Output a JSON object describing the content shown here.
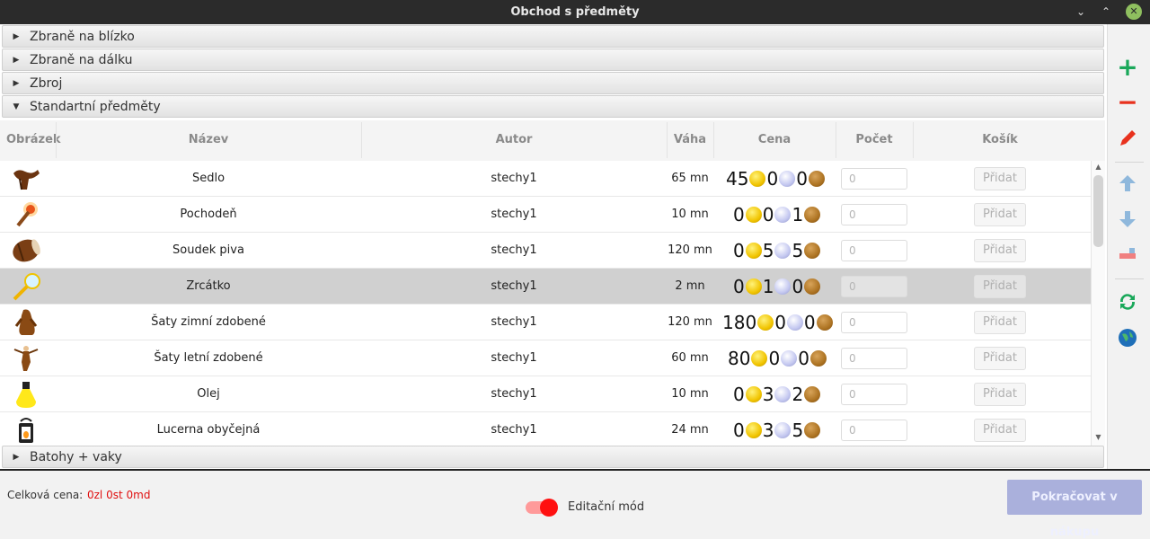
{
  "window": {
    "title": "Obchod s předměty"
  },
  "accordion": {
    "sections": [
      "Zbraně na blízko",
      "Zbraně na dálku",
      "Zbroj",
      "Standartní předměty"
    ],
    "after": "Batohy + vaky"
  },
  "table": {
    "headers": {
      "image": "Obrázek",
      "name": "Název",
      "author": "Autor",
      "weight": "Váha",
      "price": "Cena",
      "count": "Počet",
      "cart": "Košík"
    },
    "rows": [
      {
        "name": "Sedlo",
        "author": "stechy1",
        "weight": "65 mn",
        "gold": "45",
        "silver": "0",
        "copper": "0",
        "qty_placeholder": "0",
        "add": "Přidat",
        "icon": "saddle-icon"
      },
      {
        "name": "Pochodeň",
        "author": "stechy1",
        "weight": "10 mn",
        "gold": "0",
        "silver": "0",
        "copper": "1",
        "qty_placeholder": "0",
        "add": "Přidat",
        "icon": "torch-icon"
      },
      {
        "name": "Soudek piva",
        "author": "stechy1",
        "weight": "120 mn",
        "gold": "0",
        "silver": "5",
        "copper": "5",
        "qty_placeholder": "0",
        "add": "Přidat",
        "icon": "barrel-icon"
      },
      {
        "name": "Zrcátko",
        "author": "stechy1",
        "weight": "2 mn",
        "gold": "0",
        "silver": "1",
        "copper": "0",
        "qty_placeholder": "0",
        "add": "Přidat",
        "icon": "mirror-icon"
      },
      {
        "name": "Šaty zimní zdobené",
        "author": "stechy1",
        "weight": "120 mn",
        "gold": "180",
        "silver": "0",
        "copper": "0",
        "qty_placeholder": "0",
        "add": "Přidat",
        "icon": "winter-clothes-icon"
      },
      {
        "name": "Šaty letní zdobené",
        "author": "stechy1",
        "weight": "60 mn",
        "gold": "80",
        "silver": "0",
        "copper": "0",
        "qty_placeholder": "0",
        "add": "Přidat",
        "icon": "summer-clothes-icon"
      },
      {
        "name": "Olej",
        "author": "stechy1",
        "weight": "10 mn",
        "gold": "0",
        "silver": "3",
        "copper": "2",
        "qty_placeholder": "0",
        "add": "Přidat",
        "icon": "oil-flask-icon"
      },
      {
        "name": "Lucerna obyčejná",
        "author": "stechy1",
        "weight": "24 mn",
        "gold": "0",
        "silver": "3",
        "copper": "5",
        "qty_placeholder": "0",
        "add": "Přidat",
        "icon": "lantern-icon"
      }
    ],
    "selected_row_index": 3
  },
  "toolbar": {
    "icons": [
      "add-icon",
      "remove-icon",
      "edit-icon",
      "move-up-icon",
      "move-down-icon",
      "eraser-icon",
      "sync-icon",
      "globe-icon"
    ],
    "colors": {
      "add": "#1aa85a",
      "remove": "#e8321e",
      "edit": "#e8321e",
      "arrows": "#8fb8dc",
      "sync": "#1aa85a",
      "globe": "#1f6fb8"
    }
  },
  "bottom": {
    "total_label": "Celková cena:",
    "total_value": "0zl 0st 0md",
    "edit_mode_label": "Editační mód",
    "edit_mode_on": true,
    "continue_label": "Pokračovat v nákupu"
  },
  "colors": {
    "accent_red": "#ff1010",
    "button_disabled": "#aab0dc",
    "titlebar": "#2b2b2b"
  }
}
